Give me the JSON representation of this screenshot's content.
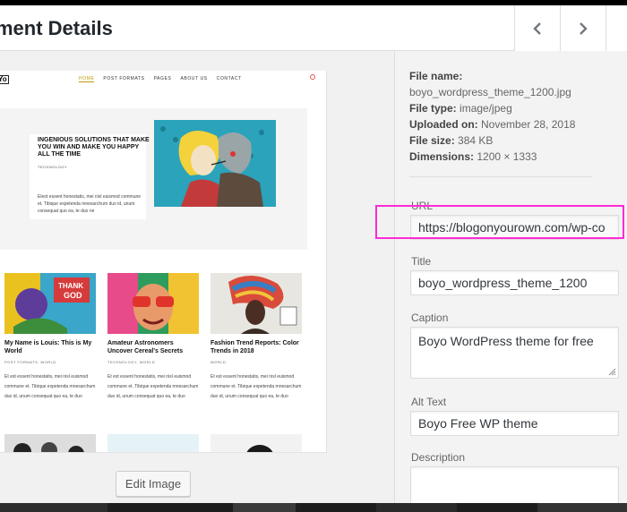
{
  "header": {
    "title": "ment Details",
    "prev_icon": "chevron-left-icon",
    "next_icon": "chevron-right-icon",
    "close_icon": "close-icon"
  },
  "preview": {
    "logo": "Yo",
    "nav": [
      "HOME",
      "POST FORMATS",
      "PAGES",
      "ABOUT US",
      "CONTACT"
    ],
    "hero": {
      "title": "INGENIOUS SOLUTIONS THAT MAKE YOU WIN AND MAKE YOU HAPPY ALL THE TIME",
      "category": "TECHNOLOGY",
      "text": "Eleot essent honestatis, mei nisl euismod commune et. Tibique expetenda mnesarchum duo id, unum consequat quo ea, te duo ne"
    },
    "cards": [
      {
        "title": "My Name is Louis: This is My World",
        "category": "POST FORMATS, WORLD",
        "text": "Et est essent honestatis, mei nisl euismod commune et. Tibique expetenda mnesarchum duo id, unum consequat quo ea, te duo"
      },
      {
        "title": "Amateur Astronomers Uncover Cereal's Secrets",
        "category": "TECHNOLOGY, WORLD",
        "text": "Et est essent honestatis, mei nisl euismod commune et. Tibique expetenda mnesarchum duo id, unum consequat quo ea, te duo"
      },
      {
        "title": "Fashion Trend Reports: Color Trends in 2018",
        "category": "WORLD",
        "text": "Et est essent honestatis, mei nisl euismod commune et. Tibique expetenda mnesarchum duo id, unum consequat quo ea, te duo"
      }
    ],
    "edit_button": "Edit Image"
  },
  "details": {
    "file_name_label": "File name:",
    "file_name": "boyo_wordpress_theme_1200.jpg",
    "file_type_label": "File type:",
    "file_type": "image/jpeg",
    "uploaded_label": "Uploaded on:",
    "uploaded": "November 28, 2018",
    "file_size_label": "File size:",
    "file_size": "384 KB",
    "dimensions_label": "Dimensions:",
    "dimensions": "1200 × 1333",
    "url_label": "URL",
    "url": "https://blogonyourown.com/wp-co",
    "title_label": "Title",
    "title": "boyo_wordpress_theme_1200",
    "caption_label": "Caption",
    "caption": "Boyo WordPress theme for free",
    "alt_label": "Alt Text",
    "alt": "Boyo Free WP theme",
    "description_label": "Description",
    "description": ""
  },
  "colors": {
    "highlight": "#ff2bd6",
    "accent": "#c29a00"
  }
}
